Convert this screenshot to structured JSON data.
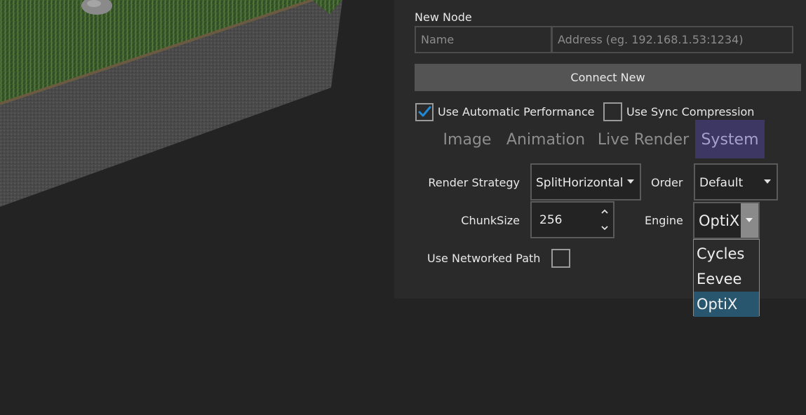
{
  "new_node": {
    "heading": "New Node",
    "name_placeholder": "Name",
    "address_placeholder": "Address (eg. 192.168.1.53:1234)",
    "connect_label": "Connect New"
  },
  "options": {
    "auto_perf_label": "Use Automatic Performance",
    "auto_perf_checked": true,
    "sync_compression_label": "Use Sync Compression",
    "sync_compression_checked": false
  },
  "tabs": [
    {
      "label": "Image",
      "active": false
    },
    {
      "label": "Animation",
      "active": false
    },
    {
      "label": "Live Render",
      "active": false
    },
    {
      "label": "System",
      "active": true
    }
  ],
  "settings": {
    "render_strategy_label": "Render Strategy",
    "render_strategy_value": "SplitHorizontal",
    "order_label": "Order",
    "order_value": "Default",
    "chunksize_label": "ChunkSize",
    "chunksize_value": "256",
    "engine_label": "Engine",
    "engine_value": "OptiX",
    "engine_options": [
      "Cycles",
      "Eevee",
      "OptiX"
    ],
    "engine_selected": "OptiX",
    "networked_path_label": "Use Networked Path",
    "networked_path_checked": false
  },
  "colors": {
    "accent_check": "#1f8ad8",
    "tab_active_bg": "#3c3863",
    "dropdown_selected_bg": "#27566e"
  }
}
